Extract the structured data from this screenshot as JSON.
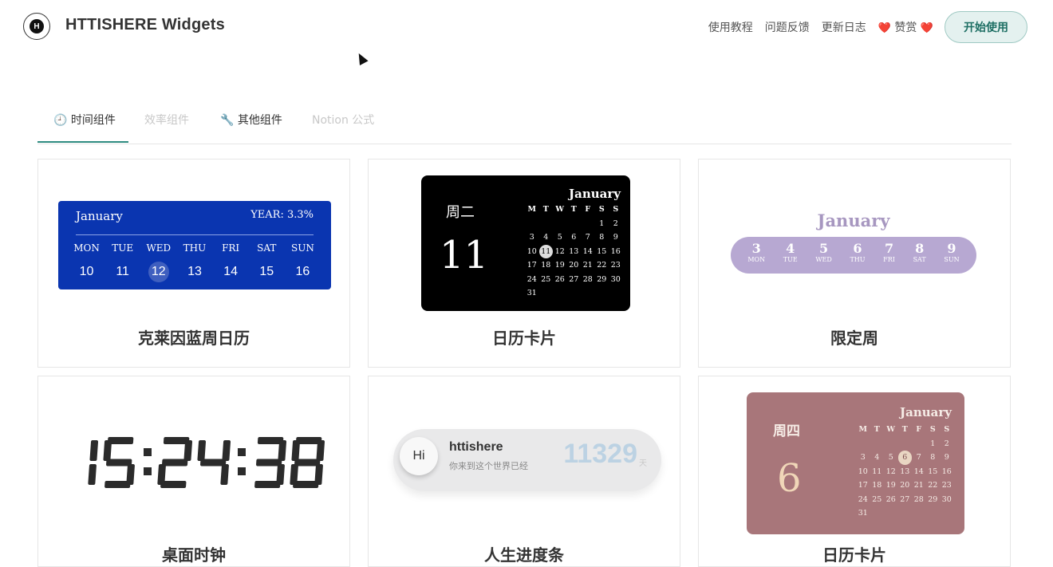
{
  "header": {
    "logo_letter": "H",
    "brand": "HTTISHERE Widgets",
    "nav": [
      "使用教程",
      "问题反馈",
      "更新日志"
    ],
    "sponsor": "赞赏",
    "start_button": "开始使用"
  },
  "tabs": [
    {
      "icon": "🕘",
      "label": "时间组件",
      "active": true
    },
    {
      "label": "效率组件",
      "disabled": true
    },
    {
      "icon": "🔧",
      "label": "其他组件"
    },
    {
      "label": "Notion 公式",
      "disabled": true
    }
  ],
  "cards": [
    {
      "title": "克莱因蓝周日历",
      "widget": {
        "month": "January",
        "year": "YEAR: 3.3%",
        "days": [
          {
            "name": "MON",
            "date": "10"
          },
          {
            "name": "TUE",
            "date": "11"
          },
          {
            "name": "WED",
            "date": "12",
            "highlight": true
          },
          {
            "name": "THU",
            "date": "13"
          },
          {
            "name": "FRI",
            "date": "14"
          },
          {
            "name": "SAT",
            "date": "15"
          },
          {
            "name": "SUN",
            "date": "16"
          }
        ],
        "color": "#0a35b0"
      }
    },
    {
      "title": "日历卡片",
      "widget": {
        "weekday": "周二",
        "day": "11",
        "month": "January",
        "headers": [
          "M",
          "T",
          "W",
          "T",
          "F",
          "S",
          "S"
        ],
        "cells": [
          "",
          "",
          "",
          "",
          "",
          "1",
          "2",
          "3",
          "4",
          "5",
          "6",
          "7",
          "8",
          "9",
          "10",
          "11",
          "12",
          "13",
          "14",
          "15",
          "16",
          "17",
          "18",
          "19",
          "20",
          "21",
          "22",
          "23",
          "24",
          "25",
          "26",
          "27",
          "28",
          "29",
          "30",
          "31"
        ],
        "selected": "11"
      }
    },
    {
      "title": "限定周",
      "widget": {
        "month": "January",
        "days": [
          {
            "date": "3",
            "name": "MON"
          },
          {
            "date": "4",
            "name": "TUE"
          },
          {
            "date": "5",
            "name": "WED"
          },
          {
            "date": "6",
            "name": "THU"
          },
          {
            "date": "7",
            "name": "FRI"
          },
          {
            "date": "8",
            "name": "SAT"
          },
          {
            "date": "9",
            "name": "SUN"
          }
        ]
      }
    },
    {
      "title": "桌面时钟",
      "widget": {
        "time": "15:24:38"
      }
    },
    {
      "title": "人生进度条",
      "widget": {
        "avatar_text": "Hi",
        "name": "httishere",
        "subtitle": "你来到这个世界已经",
        "count": "11329",
        "unit": "天"
      }
    },
    {
      "title": "日历卡片",
      "widget": {
        "weekday": "周四",
        "day": "6",
        "month": "January",
        "headers": [
          "M",
          "T",
          "W",
          "T",
          "F",
          "S",
          "S"
        ],
        "cells": [
          "",
          "",
          "",
          "",
          "",
          "1",
          "2",
          "3",
          "4",
          "5",
          "6",
          "7",
          "8",
          "9",
          "10",
          "11",
          "12",
          "13",
          "14",
          "15",
          "16",
          "17",
          "18",
          "19",
          "20",
          "21",
          "22",
          "23",
          "24",
          "25",
          "26",
          "27",
          "28",
          "29",
          "30",
          "31"
        ],
        "selected": "6"
      }
    }
  ]
}
